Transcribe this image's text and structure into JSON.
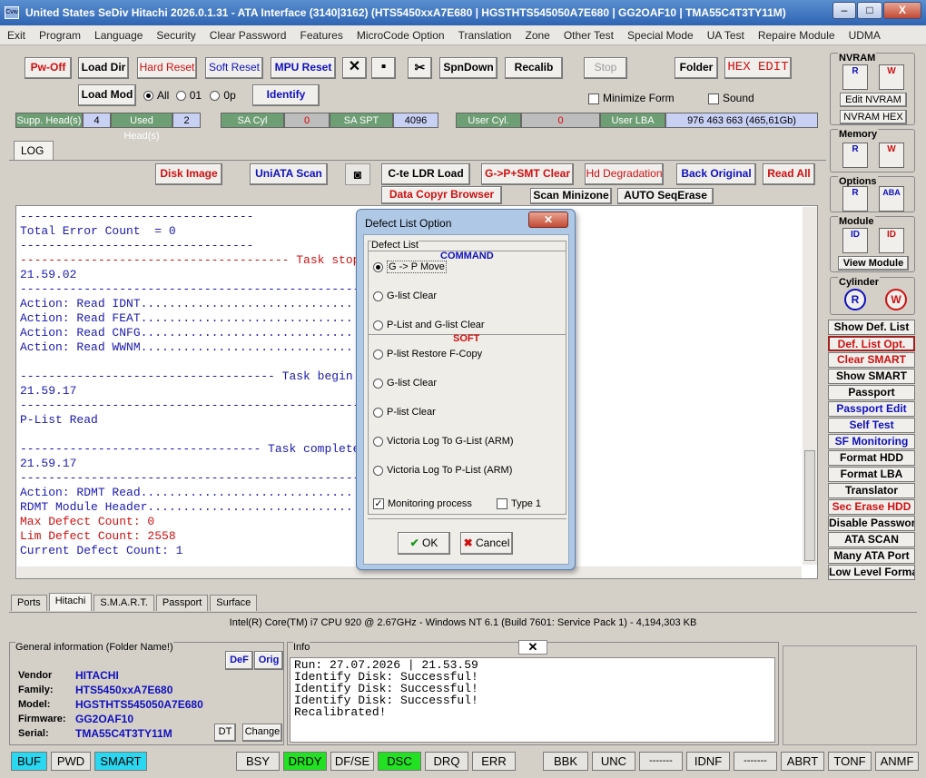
{
  "window": {
    "title": "United States  SeDiv Hitachi  2026.0.1.31 - ATA Interface  (3140|3162) (HTS5450xxA7E680 | HGSTHTS545050A7E680 | GG2OAF10 | TMA55C4T3TY11M)",
    "min": "–",
    "max": "□",
    "close": "X"
  },
  "menu": [
    "Exit",
    "Program",
    "Language",
    "Security",
    "Clear Password",
    "Features",
    "MicroCode Option",
    "Translation",
    "Zone",
    "Other Test",
    "Special Mode",
    "UA Test",
    "Repaire Module",
    "UDMA"
  ],
  "toolbar": {
    "pwoff": "Pw-Off",
    "loaddir": "Load Dir",
    "hardreset": "Hard Reset",
    "softreset": "Soft Reset",
    "mpureset": "MPU Reset",
    "x": "✕",
    "save": "▪",
    "tools": "✂",
    "spndown": "SpnDown",
    "recalib": "Recalib",
    "stop": "Stop",
    "folder": "Folder",
    "hexedit": "HEX EDIT",
    "loadmod": "Load Mod",
    "radio_all": "All",
    "radio_01": "01",
    "radio_0p": "0p",
    "identify": "Identify",
    "minimize": "Minimize Form",
    "sound": "Sound"
  },
  "status_heads": {
    "supp_label": "Supp. Head(s)",
    "supp_val": "4",
    "used_label": "Used Head(s)",
    "used_val": "2",
    "sacyl_label": "SA Cyl",
    "sacyl_val": "0",
    "saspt_label": "SA SPT",
    "saspt_val": "4096",
    "usercyl_label": "User Cyl.",
    "usercyl_val": "0",
    "userlba_label": "User LBA",
    "userlba_val": "976 463 663  (465,61Gb)"
  },
  "logtab": "LOG",
  "actions": {
    "diskimage": "Disk Image",
    "uniata": "UniATA Scan",
    "cteldr": "C-te LDR Load",
    "gpsmt": "G->P+SMT Clear",
    "hddeg": "Hd Degradation",
    "backorig": "Back Original",
    "readall": "Read All",
    "datacopy": "Data Copyr Browser",
    "scanmini": "Scan Minizone",
    "autoseq": "AUTO SeqErase"
  },
  "log": [
    {
      "t": "---------------------------------",
      "c": "b"
    },
    {
      "t": "Total Error Count  = 0",
      "c": "b"
    },
    {
      "t": "---------------------------------",
      "c": "b"
    },
    {
      "t": "-------------------------------------- Task stopped",
      "c": "r"
    },
    {
      "t": "21.59.02",
      "c": "b"
    },
    {
      "t": "--------------------------------------------------",
      "c": "b"
    },
    {
      "t": "Action: Read IDNT..............................",
      "c": "b"
    },
    {
      "t": "Action: Read FEAT..............................",
      "c": "b"
    },
    {
      "t": "Action: Read CNFG..............................",
      "c": "b"
    },
    {
      "t": "Action: Read WWNM..............................",
      "c": "b"
    },
    {
      "t": "",
      "c": "b"
    },
    {
      "t": "------------------------------------ Task begin",
      "c": "b"
    },
    {
      "t": "21.59.17",
      "c": "b"
    },
    {
      "t": "--------------------------------------------------",
      "c": "b"
    },
    {
      "t": "P-List Read",
      "c": "b"
    },
    {
      "t": "",
      "c": "b"
    },
    {
      "t": "---------------------------------- Task complete",
      "c": "b"
    },
    {
      "t": "21.59.17",
      "c": "b"
    },
    {
      "t": "--------------------------------------------------",
      "c": "b"
    },
    {
      "t": "Action: RDMT Read..............................",
      "c": "b"
    },
    {
      "t": "RDMT Module Header.............................",
      "c": "b"
    },
    {
      "t": "Max Defect Count: 0",
      "c": "r"
    },
    {
      "t": "Lim Defect Count: 2558",
      "c": "r"
    },
    {
      "t": "Current Defect Count: 1",
      "c": "b"
    }
  ],
  "dialog": {
    "title": "Defect List Option",
    "close": "✕",
    "group": "Defect List",
    "cmd_header": "COMMAND",
    "soft_header": "SOFT",
    "options": [
      "G -> P Move",
      "G-list Clear",
      "P-List and G-list Clear",
      "P-list Restore F-Copy",
      "G-list Clear",
      "P-list Clear",
      "Victoria Log To G-List (ARM)",
      "Victoria Log To P-List (ARM)"
    ],
    "monitoring": "Monitoring process",
    "type1": "Type 1",
    "ok": "OK",
    "cancel": "Cancel",
    "ok_icon": "✔",
    "cancel_icon": "✖"
  },
  "right": {
    "nvram": "NVRAM",
    "r": "R",
    "w": "W",
    "editnvram": "Edit NVRAM",
    "nvramhex": "NVRAM HEX",
    "memory": "Memory",
    "options": "Options",
    "aba": "ABA",
    "module": "Module",
    "id": "ID",
    "viewmodule": "View Module",
    "cylinder": "Cylinder"
  },
  "sidebuttons": [
    "Show Def. List",
    "Def. List Opt.",
    "Clear SMART",
    "Show SMART",
    "Passport",
    "Passport Edit",
    "Self Test",
    "SF Monitoring",
    "Format HDD",
    "Format LBA",
    "Translator",
    "Sec Erase HDD",
    "Disable Password",
    "ATA SCAN",
    "Many ATA Port",
    "Low Level Format"
  ],
  "tabs": [
    "Ports",
    "Hitachi",
    "S.M.A.R.T.",
    "Passport",
    "Surface"
  ],
  "cpu": "Intel(R) Core(TM) i7 CPU 920  @ 2.67GHz - Windows NT 6.1 (Build 7601: Service Pack 1) - 4,194,303 KB",
  "general": {
    "title": "General information (Folder Name!)",
    "def": "DeF",
    "orig": "Orig",
    "dt": "DT",
    "change": "Change",
    "vendor_l": "Vendor",
    "vendor": "HITACHI",
    "family_l": "Family:",
    "family": "HTS5450xxA7E680",
    "model_l": "Model:",
    "model": "HGSTHTS545050A7E680",
    "firmware_l": "Firmware:",
    "firmware": "GG2OAF10",
    "serial_l": "Serial:",
    "serial": "TMA55C4T3TY11M"
  },
  "info": {
    "title": "Info",
    "x": "✕",
    "text": "Run: 27.07.2026 | 21.53.59\nIdentify Disk: Successful!\nIdentify Disk: Successful!\nIdentify Disk: Successful!\nRecalibrated!"
  },
  "statusbar": [
    "BUF",
    "PWD",
    "SMART",
    "BSY",
    "DRDY",
    "DF/SE",
    "DSC",
    "DRQ",
    "ERR",
    "BBK",
    "UNC",
    "-------",
    "IDNF",
    "-------",
    "ABRT",
    "TONF",
    "ANMF"
  ]
}
